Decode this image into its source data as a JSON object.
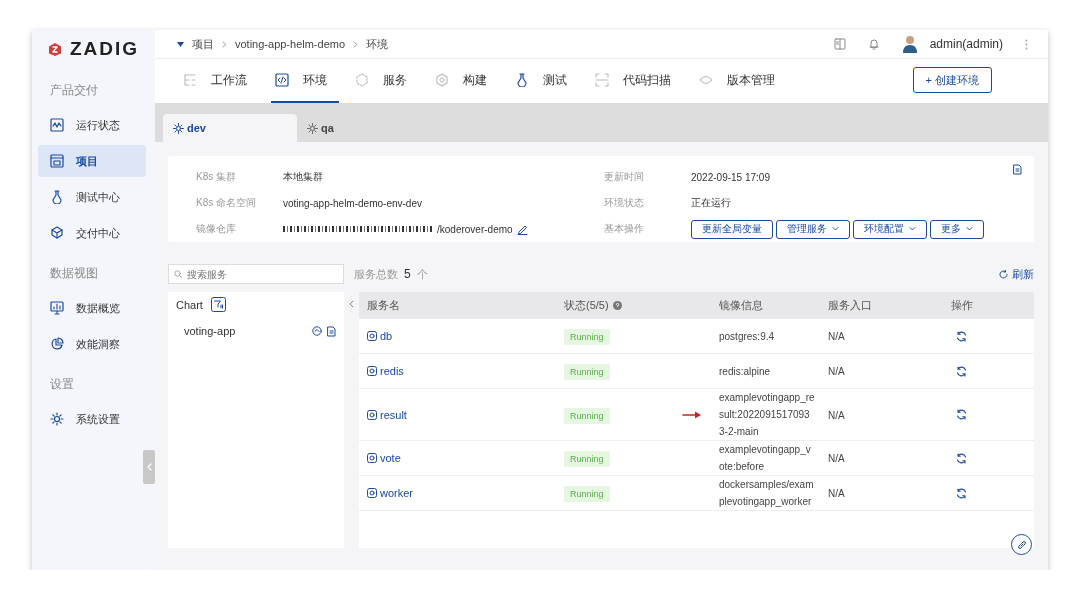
{
  "logo": {
    "text": "ZADIG"
  },
  "sidebar": {
    "sections": [
      {
        "title": "产品交付",
        "items": [
          {
            "label": "运行状态",
            "selected": false
          },
          {
            "label": "项目",
            "selected": true
          },
          {
            "label": "测试中心",
            "selected": false
          },
          {
            "label": "交付中心",
            "selected": false
          }
        ]
      },
      {
        "title": "数据视图",
        "items": [
          {
            "label": "数据概览",
            "selected": false
          },
          {
            "label": "效能洞察",
            "selected": false
          }
        ]
      },
      {
        "title": "设置",
        "items": [
          {
            "label": "系统设置",
            "selected": false
          }
        ]
      }
    ]
  },
  "breadcrumb": [
    "项目",
    "voting-app-helm-demo",
    "环境"
  ],
  "user": {
    "name": "admin(admin)"
  },
  "nav_tabs": [
    {
      "label": "工作流",
      "selected": false
    },
    {
      "label": "环境",
      "selected": true
    },
    {
      "label": "服务",
      "selected": false
    },
    {
      "label": "构建",
      "selected": false
    },
    {
      "label": "测试",
      "selected": false
    },
    {
      "label": "代码扫描",
      "selected": false
    },
    {
      "label": "版本管理",
      "selected": false
    }
  ],
  "create_button": {
    "label": "+ 创建环境"
  },
  "env_tabs": [
    {
      "label": "dev",
      "selected": true
    },
    {
      "label": "qa",
      "selected": false
    }
  ],
  "info": {
    "left": [
      {
        "label": "K8s 集群",
        "kind": "text",
        "value": "本地集群"
      },
      {
        "label": "K8s 命名空间",
        "kind": "text",
        "value": "voting-app-helm-demo-env-dev"
      },
      {
        "label": "镜像仓库",
        "kind": "registry",
        "value": "/koderover-demo"
      }
    ],
    "right": [
      {
        "label": "更新时间",
        "kind": "text",
        "value": "2022-09-15 17:09"
      },
      {
        "label": "环境状态",
        "kind": "text",
        "value": "正在运行"
      },
      {
        "label": "基本操作",
        "kind": "actions",
        "actions": [
          {
            "label": "更新全局变量",
            "dropdown": false
          },
          {
            "label": "管理服务",
            "dropdown": true
          },
          {
            "label": "环境配置",
            "dropdown": true
          },
          {
            "label": "更多",
            "dropdown": true
          }
        ]
      }
    ]
  },
  "search": {
    "placeholder": "搜索服务"
  },
  "service_total": {
    "label": "服务总数",
    "count": "5",
    "unit": "个"
  },
  "refresh": {
    "label": "刷新"
  },
  "chart_panel": {
    "title": "Chart",
    "items": [
      {
        "name": "voting-app"
      }
    ]
  },
  "table": {
    "columns": [
      "服务名",
      "状态(5/5)",
      "镜像信息",
      "服务入口",
      "操作"
    ],
    "rows": [
      {
        "name": "db",
        "status": "Running",
        "image": "postgres:9.4",
        "entry": "N/A",
        "marked": false
      },
      {
        "name": "redis",
        "status": "Running",
        "image": "redis:alpine",
        "entry": "N/A",
        "marked": false
      },
      {
        "name": "result",
        "status": "Running",
        "image": "examplevotingapp_result:20220915170933-2-main",
        "entry": "N/A",
        "marked": true
      },
      {
        "name": "vote",
        "status": "Running",
        "image": "examplevotingapp_vote:before",
        "entry": "N/A",
        "marked": false
      },
      {
        "name": "worker",
        "status": "Running",
        "image": "dockersamples/examplevotingapp_worker",
        "entry": "N/A",
        "marked": false
      }
    ]
  }
}
